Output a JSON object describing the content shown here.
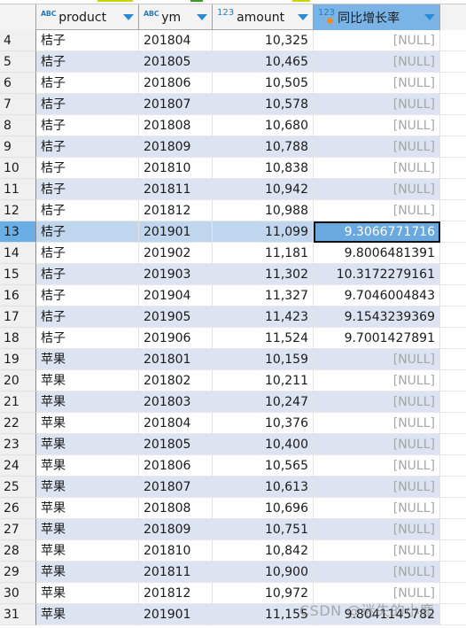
{
  "columns": [
    {
      "name": "product",
      "type_badge": "ABC",
      "sort_icon": "sort-desc-triangle"
    },
    {
      "name": "ym",
      "type_badge": "ABC",
      "sort_icon": "sort-desc-triangle"
    },
    {
      "name": "amount",
      "type_badge": "123",
      "sort_icon": "sort-desc-triangle"
    },
    {
      "name": "同比增长率",
      "type_badge": "123",
      "sort_icon": "sort-desc-triangle",
      "selected": true,
      "calculated_marker": "orange-dot"
    }
  ],
  "rows": [
    {
      "n": "4",
      "product": "桔子",
      "ym": "201804",
      "amount": "10,325",
      "yoy": "[NULL]"
    },
    {
      "n": "5",
      "product": "桔子",
      "ym": "201805",
      "amount": "10,465",
      "yoy": "[NULL]"
    },
    {
      "n": "6",
      "product": "桔子",
      "ym": "201806",
      "amount": "10,505",
      "yoy": "[NULL]"
    },
    {
      "n": "7",
      "product": "桔子",
      "ym": "201807",
      "amount": "10,578",
      "yoy": "[NULL]"
    },
    {
      "n": "8",
      "product": "桔子",
      "ym": "201808",
      "amount": "10,680",
      "yoy": "[NULL]"
    },
    {
      "n": "9",
      "product": "桔子",
      "ym": "201809",
      "amount": "10,788",
      "yoy": "[NULL]"
    },
    {
      "n": "10",
      "product": "桔子",
      "ym": "201810",
      "amount": "10,838",
      "yoy": "[NULL]"
    },
    {
      "n": "11",
      "product": "桔子",
      "ym": "201811",
      "amount": "10,942",
      "yoy": "[NULL]"
    },
    {
      "n": "12",
      "product": "桔子",
      "ym": "201812",
      "amount": "10,988",
      "yoy": "[NULL]"
    },
    {
      "n": "13",
      "product": "桔子",
      "ym": "201901",
      "amount": "11,099",
      "yoy": "9.3066771716"
    },
    {
      "n": "14",
      "product": "桔子",
      "ym": "201902",
      "amount": "11,181",
      "yoy": "9.8006481391"
    },
    {
      "n": "15",
      "product": "桔子",
      "ym": "201903",
      "amount": "11,302",
      "yoy": "10.3172279161"
    },
    {
      "n": "16",
      "product": "桔子",
      "ym": "201904",
      "amount": "11,327",
      "yoy": "9.7046004843"
    },
    {
      "n": "17",
      "product": "桔子",
      "ym": "201905",
      "amount": "11,423",
      "yoy": "9.1543239369"
    },
    {
      "n": "18",
      "product": "桔子",
      "ym": "201906",
      "amount": "11,524",
      "yoy": "9.7001427891"
    },
    {
      "n": "19",
      "product": "苹果",
      "ym": "201801",
      "amount": "10,159",
      "yoy": "[NULL]"
    },
    {
      "n": "20",
      "product": "苹果",
      "ym": "201802",
      "amount": "10,211",
      "yoy": "[NULL]"
    },
    {
      "n": "21",
      "product": "苹果",
      "ym": "201803",
      "amount": "10,247",
      "yoy": "[NULL]"
    },
    {
      "n": "22",
      "product": "苹果",
      "ym": "201804",
      "amount": "10,376",
      "yoy": "[NULL]"
    },
    {
      "n": "23",
      "product": "苹果",
      "ym": "201805",
      "amount": "10,400",
      "yoy": "[NULL]"
    },
    {
      "n": "24",
      "product": "苹果",
      "ym": "201806",
      "amount": "10,565",
      "yoy": "[NULL]"
    },
    {
      "n": "25",
      "product": "苹果",
      "ym": "201807",
      "amount": "10,613",
      "yoy": "[NULL]"
    },
    {
      "n": "26",
      "product": "苹果",
      "ym": "201808",
      "amount": "10,696",
      "yoy": "[NULL]"
    },
    {
      "n": "27",
      "product": "苹果",
      "ym": "201809",
      "amount": "10,751",
      "yoy": "[NULL]"
    },
    {
      "n": "28",
      "product": "苹果",
      "ym": "201810",
      "amount": "10,842",
      "yoy": "[NULL]"
    },
    {
      "n": "29",
      "product": "苹果",
      "ym": "201811",
      "amount": "10,900",
      "yoy": "[NULL]"
    },
    {
      "n": "30",
      "product": "苹果",
      "ym": "201812",
      "amount": "10,972",
      "yoy": "[NULL]"
    },
    {
      "n": "31",
      "product": "苹果",
      "ym": "201901",
      "amount": "11,155",
      "yoy": "9.8041145782"
    }
  ],
  "current_row": "13",
  "selected_cell": {
    "row": "13",
    "column": "同比增长率"
  },
  "null_text": "[NULL]",
  "watermark": "CSDN @迷失的小鹿",
  "colors": {
    "header_bg": "#f3f3f3",
    "selected_header_bg": "#7ab4e6",
    "alt_row_bg": "#dbe4f0",
    "current_row_bg": "#bfd6ee",
    "selected_cell_bg": "#6aa9e0",
    "type_badge": "#2a7ab8",
    "null_text": "#a6a6a6",
    "calc_marker": "#f08a24"
  }
}
